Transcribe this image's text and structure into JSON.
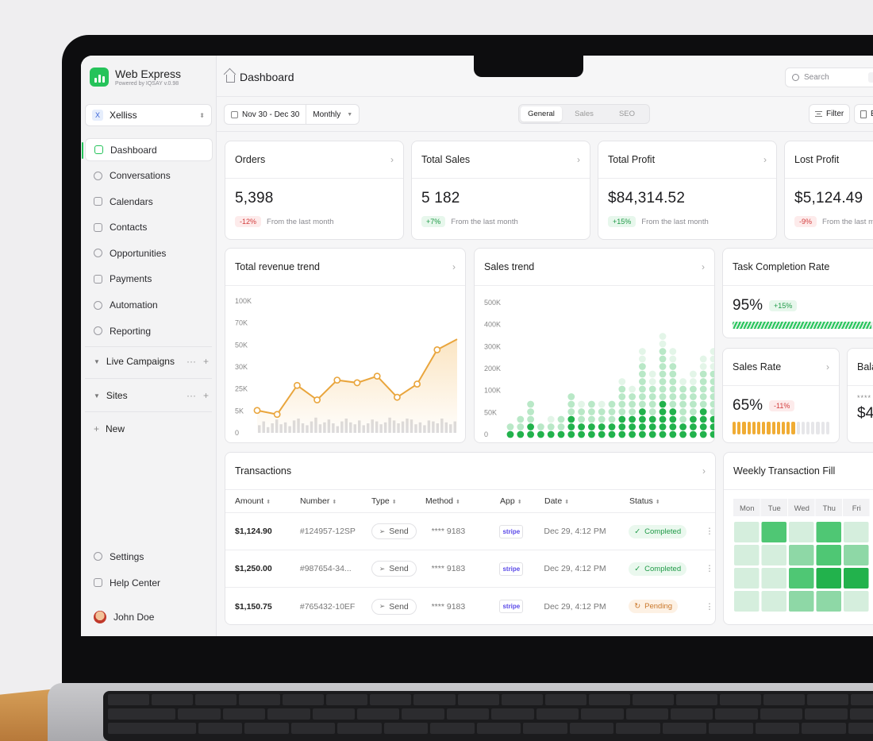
{
  "app": {
    "name": "Web Express",
    "subtitle": "Powered by IQSAY  v.0.98",
    "accent": "#25c35a"
  },
  "workspace": {
    "icon": "X",
    "name": "Xelliss"
  },
  "sidebar": {
    "items": [
      {
        "label": "Dashboard",
        "icon": "dashboard-icon",
        "active": true
      },
      {
        "label": "Conversations",
        "icon": "chat-icon"
      },
      {
        "label": "Calendars",
        "icon": "calendar-icon"
      },
      {
        "label": "Contacts",
        "icon": "contacts-icon"
      },
      {
        "label": "Opportunities",
        "icon": "opportunities-icon"
      },
      {
        "label": "Payments",
        "icon": "payments-icon"
      },
      {
        "label": "Automation",
        "icon": "automation-icon"
      },
      {
        "label": "Reporting",
        "icon": "reporting-icon"
      }
    ],
    "groups": [
      {
        "label": "Live Campaigns"
      },
      {
        "label": "Sites"
      }
    ],
    "new_label": "New",
    "settings_label": "Settings",
    "help_label": "Help Center",
    "user_name": "John Doe"
  },
  "header": {
    "title": "Dashboard",
    "search_placeholder": "Search",
    "search_shortcut": "⌘"
  },
  "toolbar": {
    "date_range": "Nov 30 - Dec 30",
    "period": "Monthly",
    "tabs": [
      "General",
      "Sales",
      "SEO"
    ],
    "active_tab": "General",
    "filter_label": "Filter",
    "export_label": "E"
  },
  "stats": [
    {
      "title": "Orders",
      "value": "5,398",
      "change": "-12%",
      "trend": "neg",
      "note": "From the last month"
    },
    {
      "title": "Total Sales",
      "value": "5 182",
      "change": "+7%",
      "trend": "pos",
      "note": "From the last month"
    },
    {
      "title": "Total Profit",
      "value": "$84,314.52",
      "change": "+15%",
      "trend": "pos",
      "note": "From the last month"
    },
    {
      "title": "Lost Profit",
      "value": "$5,124.49",
      "change": "-9%",
      "trend": "neg",
      "note": "From the last m"
    }
  ],
  "revenue_chart": {
    "title": "Total revenue trend"
  },
  "sales_chart": {
    "title": "Sales trend"
  },
  "task_completion": {
    "title": "Task Completion Rate",
    "value": "95%",
    "change": "+15%",
    "progress": 0.95
  },
  "sales_rate": {
    "title": "Sales Rate",
    "value": "65%",
    "change": "-11%",
    "progress": 0.65
  },
  "balance": {
    "title": "Bala",
    "masked": "****",
    "value": "$4"
  },
  "transactions": {
    "title": "Transactions",
    "columns": [
      "Amount",
      "Number",
      "Type",
      "Method",
      "App",
      "Date",
      "Status"
    ],
    "rows": [
      {
        "amount": "$1,124.90",
        "number": "#124957-12SP",
        "type": "Send",
        "method": "**** 9183",
        "app": "stripe",
        "date": "Dec 29, 4:12 PM",
        "status": "Completed"
      },
      {
        "amount": "$1,250.00",
        "number": "#987654-34...",
        "type": "Send",
        "method": "**** 9183",
        "app": "stripe",
        "date": "Dec 29, 4:12 PM",
        "status": "Completed"
      },
      {
        "amount": "$1,150.75",
        "number": "#765432-10EF",
        "type": "Send",
        "method": "**** 9183",
        "app": "stripe",
        "date": "Dec 29, 4:12 PM",
        "status": "Pending"
      }
    ]
  },
  "weekly_fill": {
    "title": "Weekly Transaction Fill",
    "days": [
      "Mon",
      "Tue",
      "Wed",
      "Thu",
      "Fri"
    ]
  },
  "chart_data": [
    {
      "type": "line",
      "title": "Total revenue trend",
      "y_ticks": [
        "100K",
        "70K",
        "50K",
        "30K",
        "25K",
        "5K",
        "0"
      ],
      "ylim": [
        0,
        100
      ],
      "series": [
        {
          "values": [
            17,
            14,
            36,
            25,
            40,
            38,
            43,
            27,
            37,
            63,
            71
          ]
        }
      ],
      "volume_bars": [
        8,
        12,
        6,
        10,
        14,
        9,
        11,
        7,
        13,
        15,
        10,
        8,
        12,
        16,
        9,
        11,
        14,
        10,
        7,
        12,
        15,
        11,
        9,
        13,
        8,
        10,
        14,
        12,
        9,
        11,
        16,
        13,
        10,
        12,
        15,
        14,
        9,
        11,
        8,
        13,
        12,
        10,
        15,
        11,
        9,
        12
      ]
    },
    {
      "type": "bar",
      "title": "Sales trend",
      "y_ticks": [
        "500K",
        "400K",
        "300K",
        "200K",
        "100K",
        "50K",
        "0"
      ],
      "ylim": [
        0,
        600
      ],
      "series": [
        {
          "name": "dark",
          "values": [
            1,
            1,
            2,
            1,
            1,
            1,
            3,
            2,
            2,
            2,
            2,
            3,
            3,
            4,
            3,
            5,
            4,
            2,
            3,
            4,
            3
          ]
        },
        {
          "name": "light",
          "values": [
            1,
            2,
            3,
            1,
            1,
            2,
            3,
            2,
            3,
            2,
            3,
            4,
            3,
            6,
            4,
            7,
            6,
            5,
            4,
            5,
            6
          ]
        },
        {
          "name": "faint",
          "values": [
            0,
            0,
            0,
            0,
            1,
            0,
            0,
            1,
            0,
            1,
            0,
            1,
            1,
            2,
            2,
            2,
            2,
            1,
            2,
            2,
            3
          ]
        }
      ]
    },
    {
      "type": "heatmap",
      "title": "Weekly Transaction Fill",
      "categories": [
        "Mon",
        "Tue",
        "Wed",
        "Thu",
        "Fri"
      ],
      "values": [
        [
          1,
          3,
          1,
          3,
          1
        ],
        [
          1,
          1,
          2,
          3,
          2
        ],
        [
          1,
          1,
          3,
          4,
          4
        ],
        [
          1,
          1,
          2,
          2,
          1
        ]
      ]
    }
  ]
}
